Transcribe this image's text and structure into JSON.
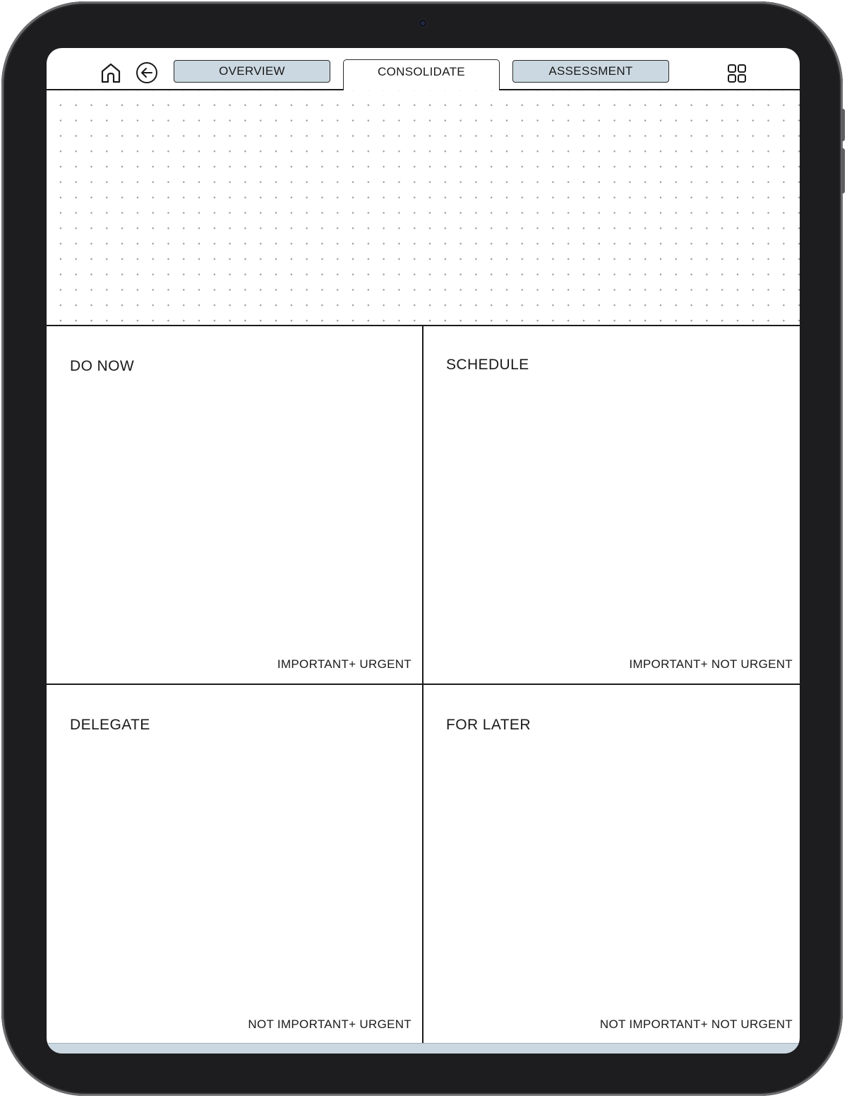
{
  "toolbar": {
    "home_icon": "home-icon",
    "back_icon": "arrow-left-circle-icon",
    "grid_icon": "grid-four-squares-icon"
  },
  "tabs": [
    {
      "label": "OVERVIEW",
      "active": false
    },
    {
      "label": "CONSOLIDATE",
      "active": true
    },
    {
      "label": "ASSESSMENT",
      "active": false
    }
  ],
  "matrix": {
    "do_now": {
      "title": "DO NOW",
      "subtitle": "IMPORTANT+ URGENT"
    },
    "schedule": {
      "title": "SCHEDULE",
      "subtitle": "IMPORTANT+ NOT URGENT"
    },
    "delegate": {
      "title": "DELEGATE",
      "subtitle": "NOT IMPORTANT+ URGENT"
    },
    "for_later": {
      "title": "FOR LATER",
      "subtitle": "NOT IMPORTANT+ NOT URGENT"
    }
  },
  "colors": {
    "tab_inactive_bg": "#cbd8e1",
    "device_frame": "#1d1d1f",
    "line": "#1a1a1a"
  }
}
